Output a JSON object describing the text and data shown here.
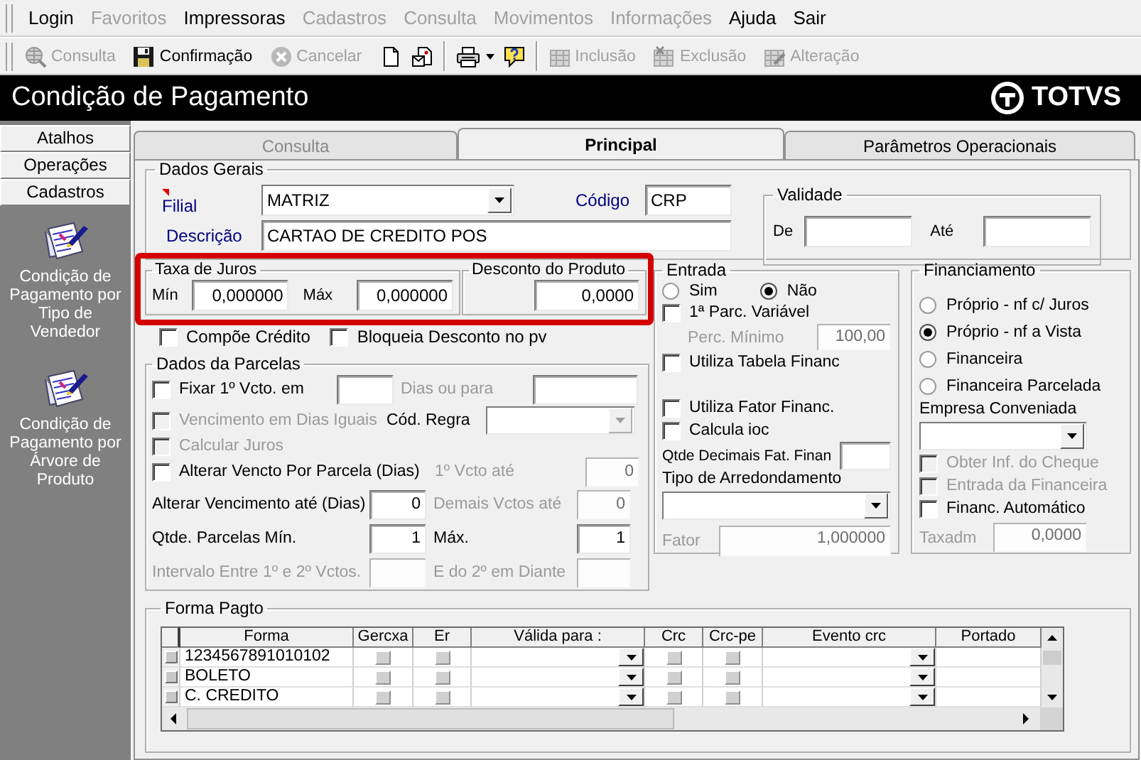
{
  "menu": [
    {
      "label": "Login",
      "disabled": false
    },
    {
      "label": "Favoritos",
      "disabled": true
    },
    {
      "label": "Impressoras",
      "disabled": false
    },
    {
      "label": "Cadastros",
      "disabled": true
    },
    {
      "label": "Consulta",
      "disabled": true
    },
    {
      "label": "Movimentos",
      "disabled": true
    },
    {
      "label": "Informações",
      "disabled": true
    },
    {
      "label": "Ajuda",
      "disabled": false
    },
    {
      "label": "Sair",
      "disabled": false
    }
  ],
  "toolbar": [
    {
      "kind": "labeled",
      "label": "Consulta",
      "disabled": true
    },
    {
      "kind": "labeled",
      "label": "Confirmação",
      "disabled": false
    },
    {
      "kind": "labeled",
      "label": "Cancelar",
      "disabled": true
    },
    {
      "kind": "icon"
    },
    {
      "kind": "icon"
    },
    {
      "kind": "separator"
    },
    {
      "kind": "dropdown"
    },
    {
      "kind": "icon"
    },
    {
      "kind": "separator"
    },
    {
      "kind": "labeled",
      "label": "Inclusão",
      "disabled": true
    },
    {
      "kind": "labeled",
      "label": "Exclusão",
      "disabled": true
    },
    {
      "kind": "labeled",
      "label": "Alteração",
      "disabled": true
    }
  ],
  "title": "Condição de Pagamento",
  "logo": "TOTVS",
  "sidebar": {
    "sections": [
      {
        "label": "Atalhos"
      },
      {
        "label": "Operações"
      },
      {
        "label": "Cadastros"
      }
    ],
    "items": [
      {
        "label": "Condição de Pagamento por Tipo de Vendedor"
      },
      {
        "label": "Condição de Pagamento por Árvore de Produto"
      }
    ]
  },
  "tabs": [
    {
      "label": "Consulta",
      "selected": false,
      "disabled": true
    },
    {
      "label": "Principal",
      "selected": true,
      "disabled": false
    },
    {
      "label": "Parâmetros Operacionais",
      "selected": false,
      "disabled": false
    }
  ],
  "dados_gerais": {
    "title": "Dados Gerais",
    "filial": {
      "label": "Filial",
      "value": "MATRIZ"
    },
    "codigo": {
      "label": "Código",
      "value": "CRP"
    },
    "descricao": {
      "label": "Descrição",
      "value": "CARTAO DE CREDITO POS"
    }
  },
  "validade": {
    "title": "Validade",
    "de": {
      "label": "De"
    },
    "ate": {
      "label": "Até"
    }
  },
  "taxa_de_juros": {
    "title": "Taxa de Juros",
    "min": {
      "label": "Mín",
      "value": "0,000000"
    },
    "max": {
      "label": "Máx",
      "value": "0,000000"
    }
  },
  "desconto_do_produto": {
    "title": "Desconto do Produto",
    "value": "0,0000"
  },
  "options": [
    {
      "label": "Compõe Crédito",
      "checked": false,
      "disabled": false
    },
    {
      "label": "Bloqueia Desconto no pv",
      "checked": false,
      "disabled": false
    }
  ],
  "dados_da_parcelas": {
    "title": "Dados da Parcelas",
    "rows": [
      {
        "kind": "fix",
        "cells": [
          {
            "kind": "checkbox",
            "label": "Fixar 1º Vcto. em",
            "checked": false,
            "disabled": false
          },
          {
            "kind": "input",
            "disabled": false
          },
          {
            "kind": "label",
            "text": "Dias ou para",
            "disabled": true
          },
          {
            "kind": "input",
            "disabled": false
          }
        ]
      },
      {
        "kind": "rule",
        "cells": [
          {
            "kind": "checkbox",
            "label": "Vencimento em Dias Iguais",
            "checked": false,
            "disabled": true
          },
          {
            "kind": "label",
            "text": "Cód. Regra",
            "disabled": false
          },
          {
            "kind": "select",
            "disabled": true
          }
        ]
      },
      {
        "kind": "check",
        "cells": [
          {
            "kind": "checkbox",
            "label": "Calcular Juros",
            "checked": false,
            "disabled": true
          }
        ]
      },
      {
        "kind": "check-pair",
        "cells": [
          {
            "kind": "checkbox",
            "label": "Alterar Vencto Por Parcela (Dias)",
            "checked": false,
            "disabled": false
          },
          {
            "kind": "label",
            "text": "1º Vcto até",
            "disabled": true
          },
          {
            "kind": "input",
            "value": "0",
            "disabled": true
          }
        ]
      },
      {
        "kind": "pair",
        "cells": [
          {
            "kind": "label",
            "text": "Alterar Vencimento até (Dias)",
            "disabled": false
          },
          {
            "kind": "input",
            "value": "0",
            "disabled": false
          },
          {
            "kind": "label",
            "text": "Demais Vctos até",
            "disabled": true
          },
          {
            "kind": "input",
            "value": "0",
            "disabled": true
          }
        ]
      },
      {
        "kind": "pair",
        "cells": [
          {
            "kind": "label",
            "text": "Qtde. Parcelas Mín.",
            "disabled": false
          },
          {
            "kind": "input",
            "value": "1",
            "disabled": false
          },
          {
            "kind": "label",
            "text": "Máx.",
            "disabled": false
          },
          {
            "kind": "input",
            "value": "1",
            "disabled": false
          }
        ]
      },
      {
        "kind": "pair",
        "cells": [
          {
            "kind": "label",
            "text": "Intervalo Entre 1º e 2º Vctos.",
            "disabled": true
          },
          {
            "kind": "input",
            "disabled": true
          },
          {
            "kind": "label",
            "text": "E do 2º em Diante",
            "disabled": true
          },
          {
            "kind": "input",
            "disabled": true
          }
        ]
      }
    ]
  },
  "entrada": {
    "title": "Entrada",
    "items": [
      {
        "kind": "radios",
        "options": [
          {
            "label": "Sim",
            "selected": false
          },
          {
            "label": "Não",
            "selected": true
          }
        ]
      },
      {
        "kind": "checkbox",
        "label": "1ª Parc. Variável",
        "checked": false,
        "disabled": false
      },
      {
        "kind": "field",
        "label": "Perc. Mínimo",
        "value": "100,00",
        "disabled": true
      },
      {
        "kind": "checkbox",
        "label": "Utiliza Tabela Financ",
        "checked": false,
        "disabled": false
      },
      {
        "kind": "checkbox",
        "label": "Utiliza Fator Financ.",
        "checked": false,
        "disabled": false
      },
      {
        "kind": "checkbox",
        "label": "Calcula ioc",
        "checked": false,
        "disabled": false
      },
      {
        "kind": "field",
        "label": "Qtde Decimais Fat. Finan",
        "disabled": false
      },
      {
        "kind": "label",
        "text": "Tipo de Arredondamento",
        "disabled": false
      },
      {
        "kind": "select",
        "disabled": false
      },
      {
        "kind": "field",
        "label": "Fator",
        "value": "1,000000",
        "disabled": true
      }
    ]
  },
  "financiamento": {
    "title": "Financiamento",
    "items": [
      {
        "kind": "radios",
        "options": [
          {
            "label": "Próprio - nf c/ Juros",
            "selected": false
          },
          {
            "label": "Próprio - nf a Vista",
            "selected": true
          },
          {
            "label": "Financeira",
            "selected": false
          },
          {
            "label": "Financeira Parcelada",
            "selected": false
          }
        ]
      },
      {
        "kind": "label",
        "text": "Empresa Conveniada",
        "disabled": false
      },
      {
        "kind": "select",
        "disabled": false
      },
      {
        "kind": "checkbox",
        "label": "Obter Inf. do Cheque",
        "checked": false,
        "disabled": true
      },
      {
        "kind": "checkbox",
        "label": "Entrada da Financeira",
        "checked": false,
        "disabled": true
      },
      {
        "kind": "checkbox",
        "label": "Financ. Automático",
        "checked": false,
        "disabled": false
      },
      {
        "kind": "field",
        "label": "Taxadm",
        "value": "0,0000",
        "disabled": true
      }
    ]
  },
  "forma_pagto": {
    "title": "Forma Pagto",
    "columns": [
      "Forma",
      "Gercxa",
      "Er",
      "Válida para :",
      "Crc",
      "Crc-pe",
      "Evento crc",
      "Portado"
    ],
    "rows": [
      {
        "forma": "1234567891010102",
        "gercxa": false,
        "er": false,
        "crc": false,
        "crc_pe": false
      },
      {
        "forma": "BOLETO",
        "gercxa": false,
        "er": false,
        "crc": false,
        "crc_pe": false
      },
      {
        "forma": "C. CREDITO",
        "gercxa": false,
        "er": false,
        "crc": false,
        "crc_pe": false
      }
    ]
  }
}
